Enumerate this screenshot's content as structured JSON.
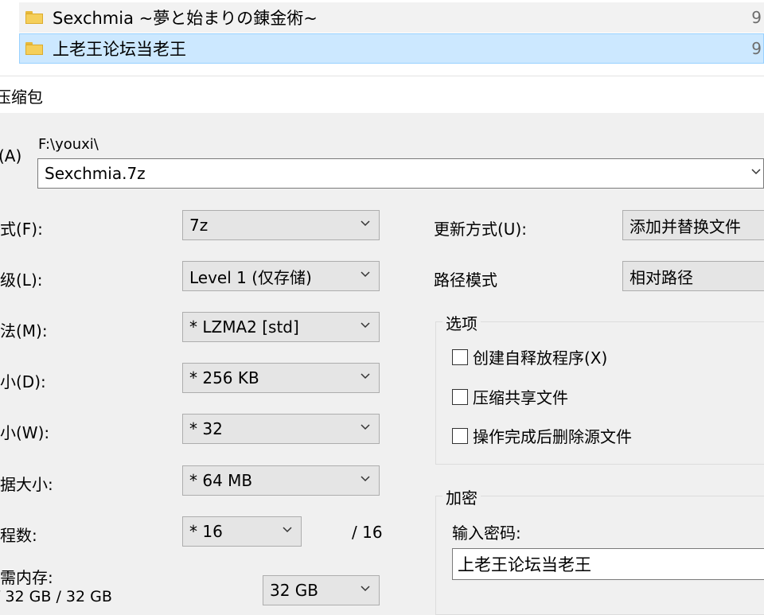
{
  "explorer": {
    "rows": [
      {
        "name": "Sexchmia ~夢と始まりの錬金術~",
        "size": "9"
      },
      {
        "name": "上老王论坛当老王",
        "size": "9"
      }
    ]
  },
  "dialog": {
    "title": "压缩包",
    "archive": {
      "label": "(A)",
      "path": "F:\\youxi\\",
      "filename": "Sexchmia.7z"
    },
    "left": {
      "format_label": "式(F):",
      "format_value": "7z",
      "level_label": "级(L):",
      "level_value": "Level 1 (仅存储)",
      "method_label": "法(M):",
      "method_value": "* LZMA2 [std]",
      "dict_label": "小(D):",
      "dict_value": "* 256 KB",
      "word_label": "小(W):",
      "word_value": "* 32",
      "block_label": "据大小:",
      "block_value": "* 64 MB",
      "threads_label": "程数:",
      "threads_value": "* 16",
      "threads_max": "/ 16",
      "memory_label": "需内存:",
      "memory_info": "/ 32 GB / 32 GB",
      "memory_value": "32 GB"
    },
    "right": {
      "update_label": "更新方式(U):",
      "update_value": "添加并替换文件",
      "path_label": "路径模式",
      "path_value": "相对路径",
      "options_title": "选项",
      "opt_sfx": "创建自释放程序(X)",
      "opt_shared": "压缩共享文件",
      "opt_delete": "操作完成后删除源文件",
      "encrypt_title": "加密",
      "password_label": "输入密码:",
      "password_value": "上老王论坛当老王"
    }
  }
}
